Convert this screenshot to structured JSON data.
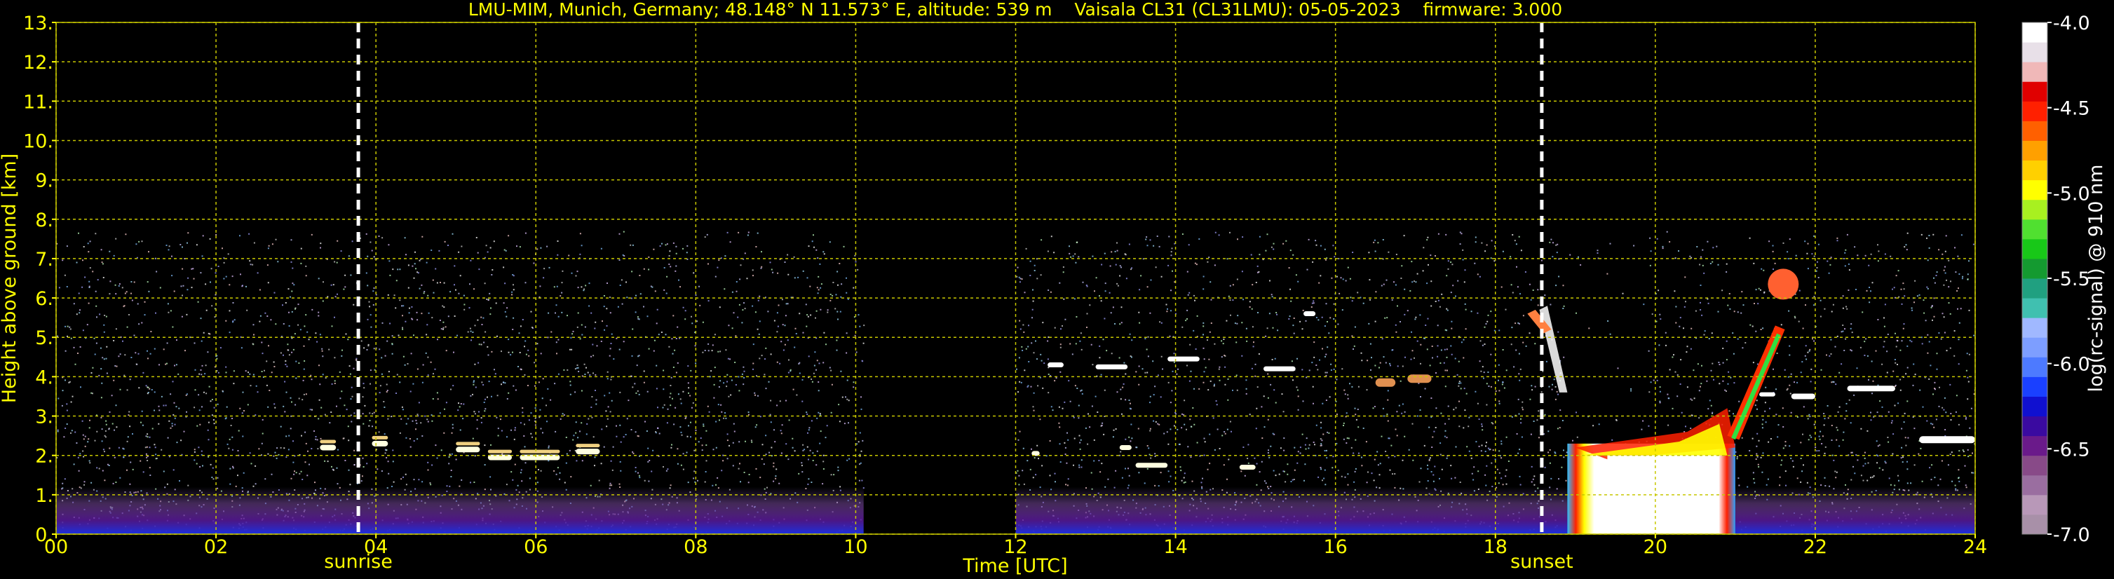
{
  "chart_data": {
    "type": "heatmap",
    "title": "LMU-MIM, Munich, Germany; 48.148° N 11.573° E, altitude: 539 m    Vaisala CL31 (CL31LMU): 05-05-2023    firmware: 3.000",
    "xlabel": "Time [UTC]",
    "ylabel": "Height above ground [km]",
    "xlim": [
      0,
      24
    ],
    "ylim": [
      0,
      13
    ],
    "x_ticks": [
      "00",
      "02",
      "04",
      "06",
      "08",
      "10",
      "12",
      "14",
      "16",
      "18",
      "20",
      "22",
      "24"
    ],
    "y_ticks": [
      "0.",
      "1.",
      "2.",
      "3.",
      "4.",
      "5.",
      "6.",
      "7.",
      "8.",
      "9.",
      "10.",
      "11.",
      "12.",
      "13."
    ],
    "grid": true,
    "sunrise": {
      "time": 3.78,
      "label": "sunrise"
    },
    "sunset": {
      "time": 18.58,
      "label": "sunset"
    },
    "max_range_km": 7.7,
    "colorbar": {
      "label": "log(rc-signal) @ 910 nm",
      "ticks": [
        "-4.0",
        "-4.5",
        "-5.0",
        "-5.5",
        "-6.0",
        "-6.5",
        "-7.0"
      ],
      "range": [
        -7.0,
        -4.0
      ],
      "colors": [
        "#a890a8",
        "#b898b8",
        "#9a6ea0",
        "#884a88",
        "#6a1a8a",
        "#3a0aa0",
        "#1010d0",
        "#1a40ff",
        "#4d7aff",
        "#7d9eff",
        "#a0b8ff",
        "#40c0b0",
        "#20a080",
        "#149a30",
        "#18c818",
        "#50e030",
        "#a8f020",
        "#ffff00",
        "#ffd000",
        "#ffa000",
        "#ff6000",
        "#ff2000",
        "#e00000",
        "#f0b8b8",
        "#e8e0e8",
        "#ffffff"
      ]
    },
    "features": [
      {
        "name": "boundary layer aerosol",
        "type": "layer",
        "x": [
          0,
          24
        ],
        "y": [
          0,
          1.2
        ]
      },
      {
        "name": "no-data gap",
        "type": "gap",
        "x": [
          10.1,
          12.0
        ]
      },
      {
        "name": "morning clouds",
        "type": "cloud",
        "x": [
          3.3,
          6.8
        ],
        "y": [
          1.9,
          2.5
        ]
      },
      {
        "name": "midday clouds",
        "type": "cloud",
        "x": [
          12.2,
          15.0
        ],
        "y": [
          1.6,
          2.2
        ]
      },
      {
        "name": "altocumulus",
        "type": "cloud",
        "x": [
          12.3,
          15.6
        ],
        "y": [
          4.1,
          4.5
        ]
      },
      {
        "name": "evening rain/cloud",
        "type": "strong",
        "x": [
          18.9,
          21.0
        ],
        "y": [
          0,
          2.6
        ]
      },
      {
        "name": "cloud base rising",
        "type": "cloud",
        "x": [
          20.9,
          21.6
        ],
        "y": [
          2.5,
          5.2
        ]
      },
      {
        "name": "cloud at 6 km",
        "type": "cloud",
        "x": [
          21.4,
          21.6
        ],
        "y": [
          6.2,
          6.5
        ]
      },
      {
        "name": "night clouds",
        "type": "cloud",
        "x": [
          21.3,
          23.0
        ],
        "y": [
          3.4,
          3.8
        ]
      },
      {
        "name": "late clouds",
        "type": "cloud",
        "x": [
          23.3,
          24
        ],
        "y": [
          2.3,
          2.5
        ]
      }
    ]
  }
}
